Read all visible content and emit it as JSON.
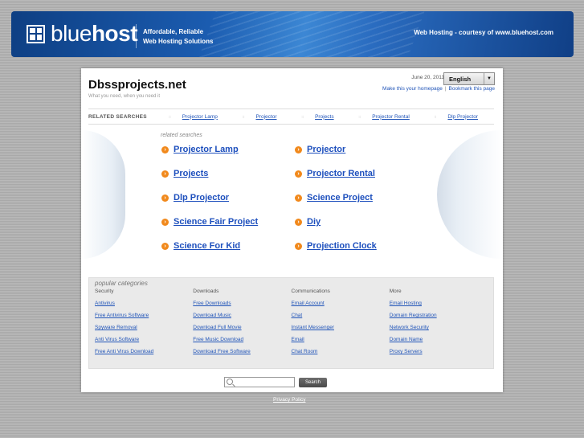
{
  "banner": {
    "logo_light": "blue",
    "logo_bold": "host",
    "tagline_line1": "Affordable, Reliable",
    "tagline_line2": "Web Hosting Solutions",
    "courtesy": "Web Hosting - courtesy of www.bluehost.com"
  },
  "site": {
    "title": "Dbssprojects.net",
    "subtitle": "What you need, when you need it",
    "date": "June 20, 2011",
    "language": "English",
    "make_homepage": "Make this your homepage",
    "bookmark": "Bookmark this page"
  },
  "related_bar": {
    "label": "RELATED SEARCHES",
    "items": [
      "Projector Lamp",
      "Projector",
      "Projects",
      "Projector Rental",
      "Dlp Projector"
    ]
  },
  "results": {
    "heading": "related searches",
    "items": [
      "Projector Lamp",
      "Projector",
      "Projects",
      "Projector Rental",
      "Dlp Projector",
      "Science Project",
      "Science Fair Project",
      "Diy",
      "Science For Kid",
      "Projection Clock"
    ]
  },
  "popular": {
    "title": "popular categories",
    "columns": [
      {
        "head": "Security",
        "links": [
          "Antivirus",
          "Free Antivirus Software",
          "Spyware Removal",
          "Anti Virus Software",
          "Free Anti Virus Download"
        ]
      },
      {
        "head": "Downloads",
        "links": [
          "Free Downloads",
          "Download Music",
          "Download Full Movie",
          "Free Music Download",
          "Download Free Software"
        ]
      },
      {
        "head": "Communications",
        "links": [
          "Email Account",
          "Chat",
          "Instant Messenger",
          "Email",
          "Chat Room"
        ]
      },
      {
        "head": "More",
        "links": [
          "Email Hosting",
          "Domain Registration",
          "Network Security",
          "Domain Name",
          "Proxy Servers"
        ]
      }
    ]
  },
  "search": {
    "placeholder": "",
    "button": "Search"
  },
  "footer": {
    "privacy": "Privacy Policy"
  }
}
